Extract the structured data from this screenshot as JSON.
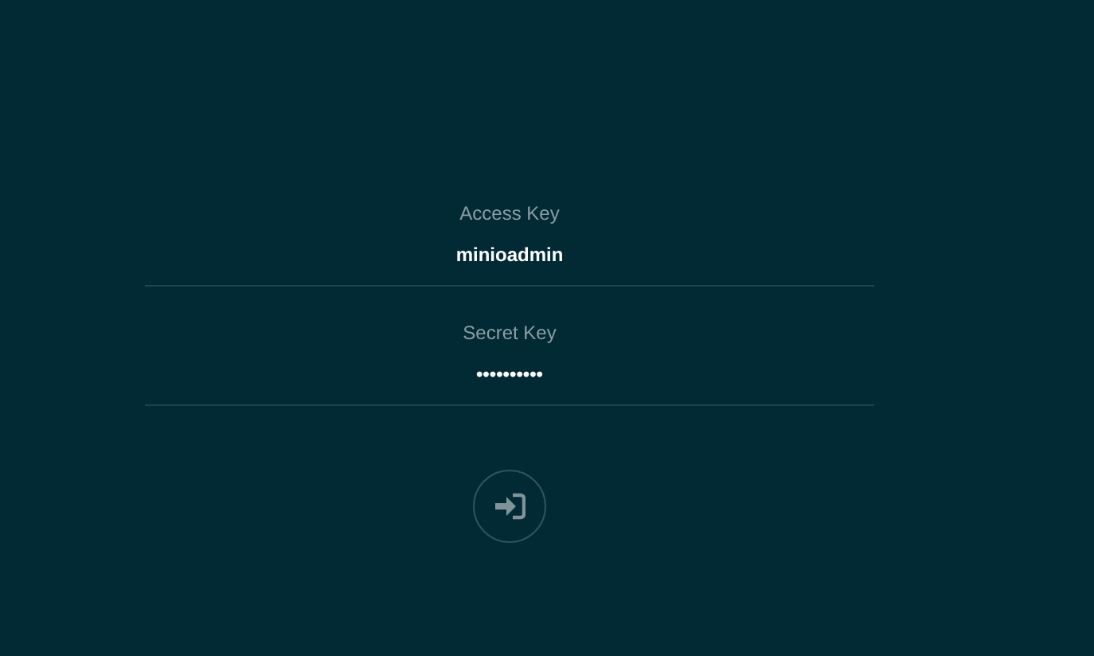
{
  "fields": [
    {
      "label": "Access Key",
      "value": "minioadmin"
    },
    {
      "label": "Secret Key",
      "value": "••••••••••"
    }
  ]
}
